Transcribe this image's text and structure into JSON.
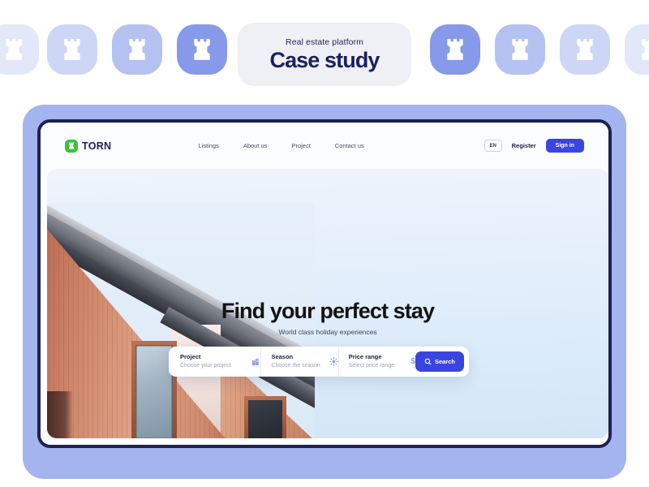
{
  "badge": {
    "eyebrow": "Real estate platform",
    "title": "Case study",
    "background": "#eff0f6",
    "title_color": "#1b2060"
  },
  "icon_strip": {
    "icon_name": "rook-tower-icon",
    "tiles": [
      {
        "opacity": 0.22
      },
      {
        "opacity": 0.38
      },
      {
        "opacity": 0.58
      },
      {
        "opacity": 0.95
      },
      {
        "opacity": 0.95
      },
      {
        "opacity": 0.58
      },
      {
        "opacity": 0.38
      },
      {
        "opacity": 0.22
      }
    ],
    "tile_color": "#8095e8"
  },
  "frame": {
    "panel_color": "#a3b4ee",
    "border_color": "#1d2150"
  },
  "site": {
    "logo": {
      "text": "TORN",
      "mark_color": "#3ec13e",
      "mark_icon": "rook-tower-icon"
    },
    "nav_links": [
      {
        "label": "Listings"
      },
      {
        "label": "About us"
      },
      {
        "label": "Project"
      },
      {
        "label": "Contact us"
      }
    ],
    "actions": {
      "language": "EN",
      "register_label": "Register",
      "signin_label": "Sign in",
      "signin_color": "#3a45e0"
    },
    "hero": {
      "title": "Find your perfect stay",
      "subtitle": "World class holiday experiences",
      "photo_alt": "wooden-clad-gable-house"
    },
    "search": {
      "fields": [
        {
          "label": "Project",
          "placeholder": "Choose your project",
          "icon": "building-icon"
        },
        {
          "label": "Season",
          "placeholder": "Choose the season",
          "icon": "sun-icon"
        },
        {
          "label": "Price range",
          "placeholder": "Select price range",
          "icon": "dollar-icon",
          "icon_glyph": "$"
        }
      ],
      "button_label": "Search",
      "button_icon": "search-icon",
      "button_color": "#3a45e0"
    }
  }
}
